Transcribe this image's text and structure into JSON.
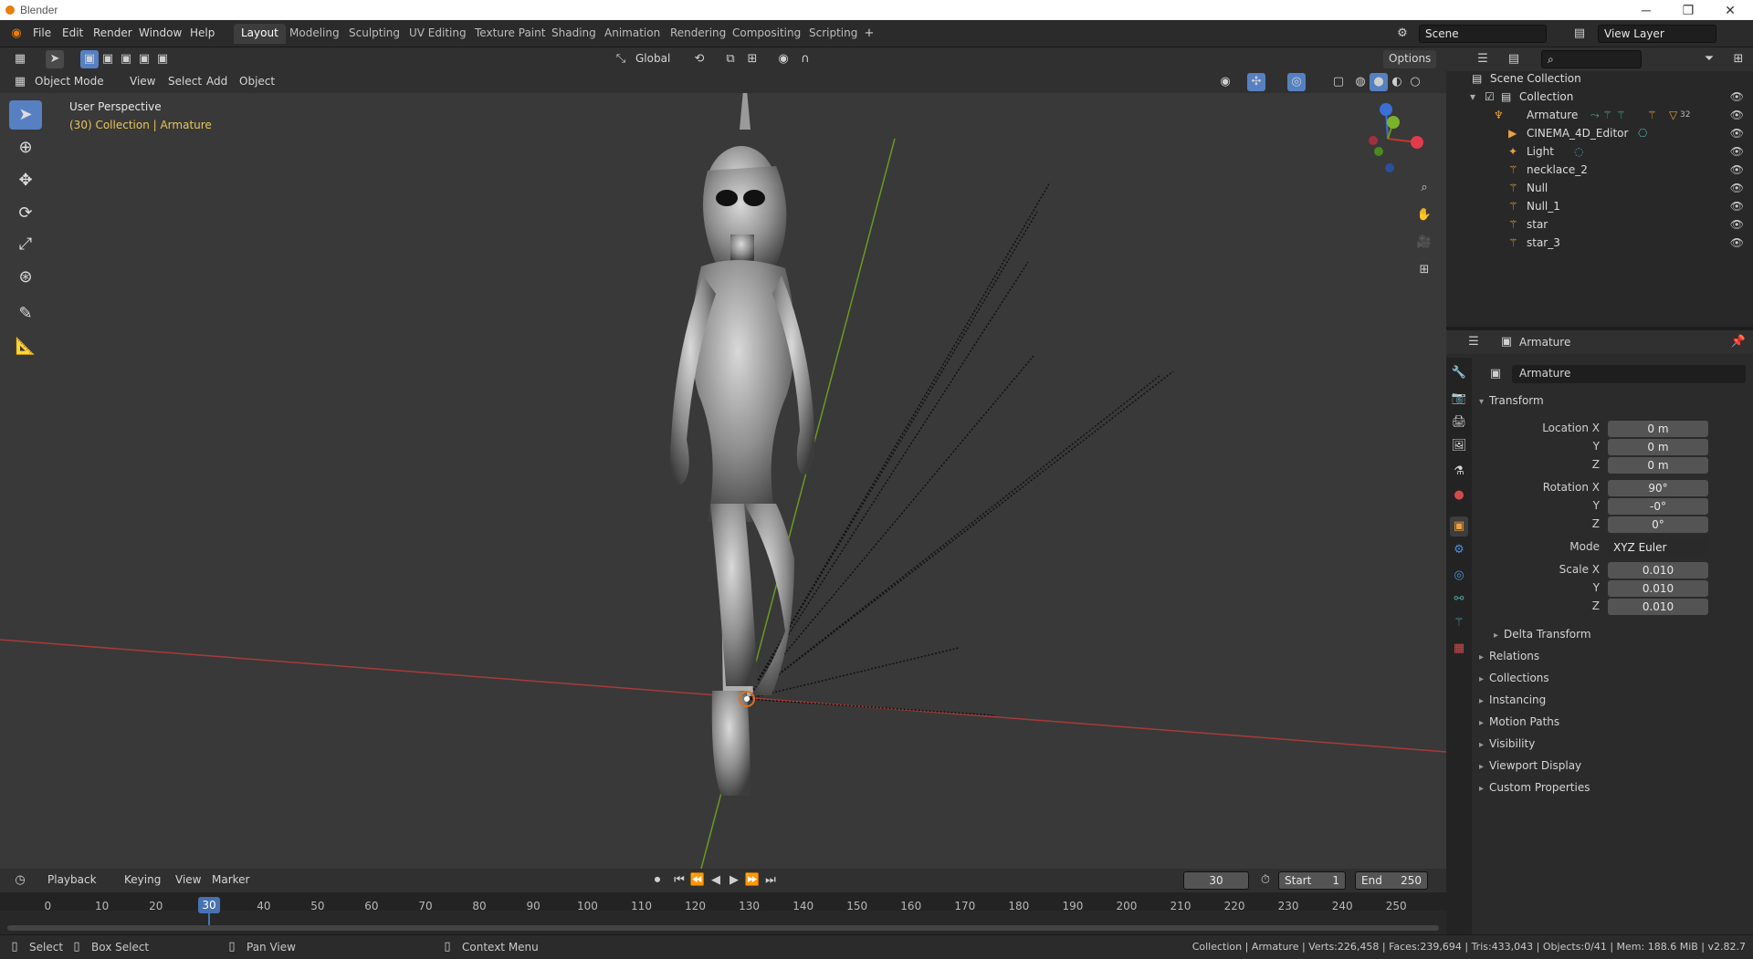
{
  "window": {
    "title": "Blender"
  },
  "menus": [
    "File",
    "Edit",
    "Render",
    "Window",
    "Help"
  ],
  "workspaces": [
    "Layout",
    "Modeling",
    "Sculpting",
    "UV Editing",
    "Texture Paint",
    "Shading",
    "Animation",
    "Rendering",
    "Compositing",
    "Scripting"
  ],
  "scene": {
    "name": "Scene",
    "view_layer": "View Layer"
  },
  "viewport_header": {
    "mode": "Object Mode",
    "menus": [
      "View",
      "Select",
      "Add",
      "Object"
    ],
    "transform_orientation": "Global",
    "options_label": "Options"
  },
  "viewport": {
    "perspective_label": "User Perspective",
    "context_label": "(30) Collection | Armature"
  },
  "outliner": {
    "root": "Scene Collection",
    "collection": "Collection",
    "items": [
      "Armature",
      "CINEMA_4D_Editor",
      "Light",
      "necklace_2",
      "Null",
      "Null_1",
      "star",
      "star_3"
    ],
    "armature_badge": "32"
  },
  "properties": {
    "object_name": "Armature",
    "name_field": "Armature",
    "transform_title": "Transform",
    "location_label": "Location X",
    "rotation_label": "Rotation X",
    "scale_label": "Scale X",
    "y_label": "Y",
    "z_label": "Z",
    "mode_label": "Mode",
    "location": [
      "0 m",
      "0 m",
      "0 m"
    ],
    "rotation": [
      "90°",
      "-0°",
      "0°"
    ],
    "rotation_mode": "XYZ Euler",
    "scale": [
      "0.010",
      "0.010",
      "0.010"
    ],
    "panels": [
      "Delta Transform",
      "Relations",
      "Collections",
      "Instancing",
      "Motion Paths",
      "Visibility",
      "Viewport Display",
      "Custom Properties"
    ]
  },
  "timeline": {
    "menus": [
      "Playback",
      "Keying",
      "View",
      "Marker"
    ],
    "current_frame": "30",
    "start_label": "Start",
    "start": "1",
    "end_label": "End",
    "end": "250",
    "ticks": [
      "0",
      "10",
      "20",
      "30",
      "40",
      "50",
      "60",
      "70",
      "80",
      "90",
      "100",
      "110",
      "120",
      "130",
      "140",
      "150",
      "160",
      "170",
      "180",
      "190",
      "200",
      "210",
      "220",
      "230",
      "240",
      "250"
    ]
  },
  "statusbar": {
    "select": "Select",
    "box_select": "Box Select",
    "pan_view": "Pan View",
    "context_menu": "Context Menu",
    "stats": "Collection | Armature | Verts:226,458 | Faces:239,694 | Tris:433,043 | Objects:0/41 | Mem: 188.6 MiB | v2.82.7"
  },
  "colors": {
    "accent": "#5680c2",
    "frame": "#4772b3",
    "x_axis": "#c0392b",
    "y_axis": "#6a9a1f"
  }
}
